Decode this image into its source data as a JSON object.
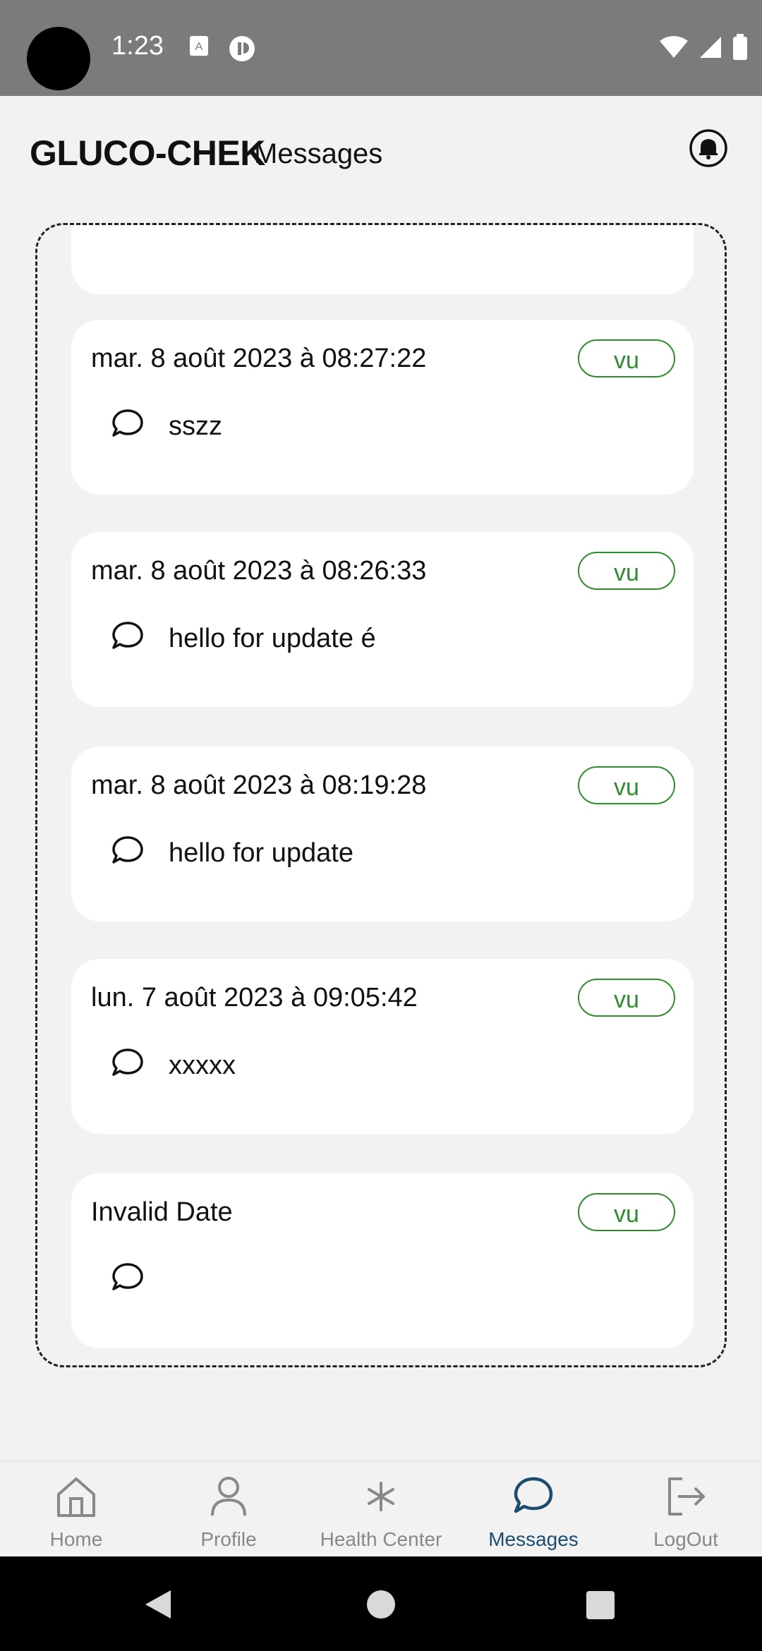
{
  "status": {
    "time": "1:23"
  },
  "header": {
    "brand": "GLUCO-CHEK",
    "title": "Messages"
  },
  "messages": [
    {
      "date": "mar. 8 août 2023 à 08:27:22",
      "badge": "vu",
      "text": "sszz"
    },
    {
      "date": "mar. 8 août 2023 à 08:26:33",
      "badge": "vu",
      "text": "hello for update é"
    },
    {
      "date": "mar. 8 août 2023 à 08:19:28",
      "badge": "vu",
      "text": "hello for update"
    },
    {
      "date": "lun. 7 août 2023 à 09:05:42",
      "badge": "vu",
      "text": "xxxxx"
    },
    {
      "date": "Invalid Date",
      "badge": "vu",
      "text": ""
    }
  ],
  "nav": {
    "items": [
      {
        "label": "Home",
        "icon": "home-icon"
      },
      {
        "label": "Profile",
        "icon": "person-icon"
      },
      {
        "label": "Health Center",
        "icon": "asterisk-icon"
      },
      {
        "label": "Messages",
        "icon": "chat-icon"
      },
      {
        "label": "LogOut",
        "icon": "logout-icon"
      }
    ],
    "active": "Messages"
  },
  "colors": {
    "badge_green": "#2e8b2e",
    "active_nav": "#1a4d6e",
    "status_bar": "#7b7b7b"
  }
}
